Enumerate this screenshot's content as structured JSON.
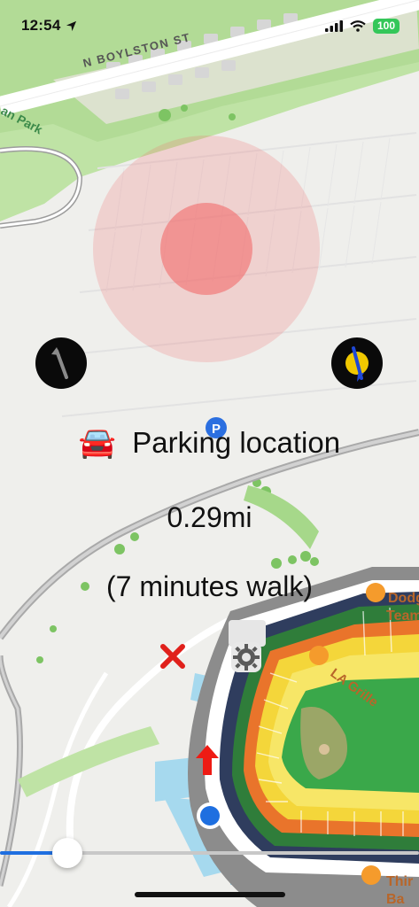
{
  "status_bar": {
    "time": "12:54",
    "battery": "100"
  },
  "map": {
    "street_label": "N BOYLSTON ST",
    "park_label": "an Park",
    "poi_dodgers": "Dodg",
    "poi_dodgers_2": "Team",
    "poi_la_grille": "LA Grille",
    "poi_third": "Thir",
    "poi_third_2": "Ba",
    "parking_glyph": "P"
  },
  "parking": {
    "icon": "🚘",
    "label": "Parking location",
    "distance": "0.29mi",
    "walk_time": "(7 minutes walk)"
  },
  "controls": {
    "close_icon": "close-icon",
    "settings_icon": "gear-icon",
    "direction_icon": "arrow-up-icon",
    "slider_value": 0.13
  },
  "colors": {
    "accuracy_circle": "#f26a6a",
    "close_red": "#e0201b",
    "arrow_red": "#ee1b14",
    "slider_fill": "#1f6fe0",
    "user_dot": "#1e6fe0",
    "battery": "#34c759",
    "compass_needle_blue": "#1f48d6",
    "compass_face_yellow": "#f0c800"
  }
}
